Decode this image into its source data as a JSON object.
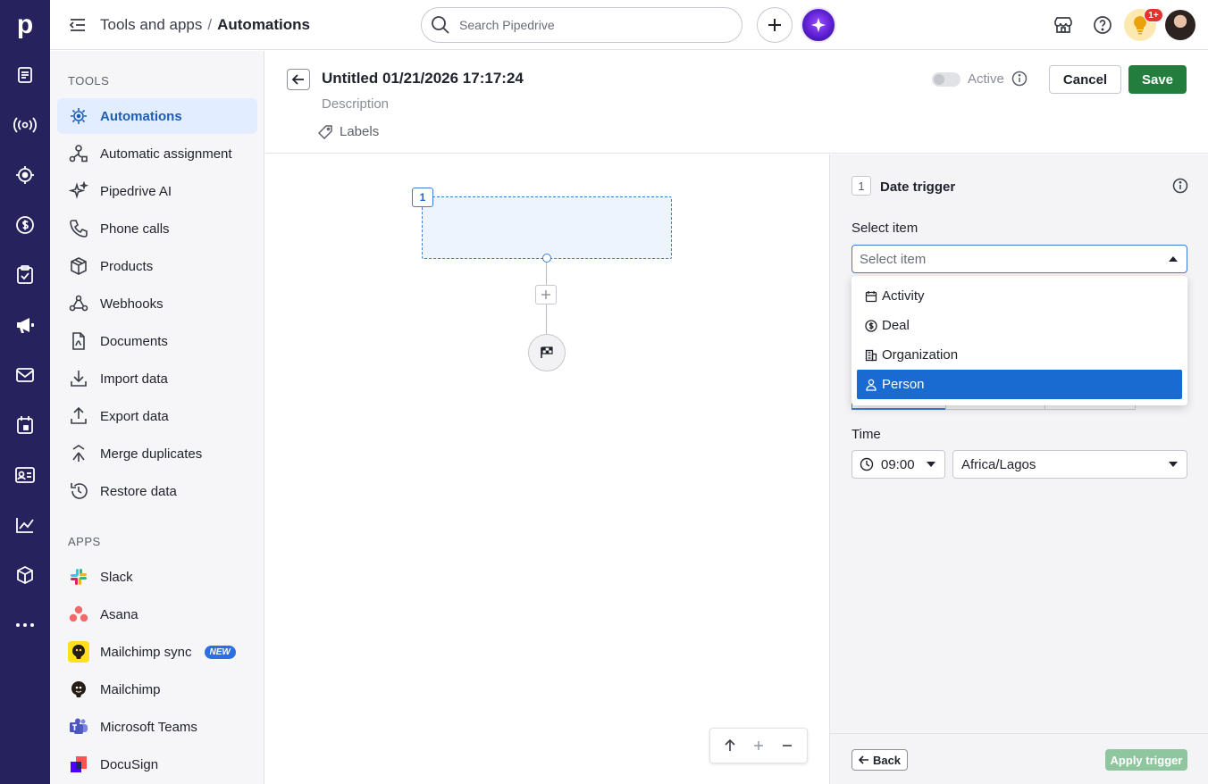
{
  "rail": {
    "logo": "p",
    "icons": [
      "leads-icon",
      "campaigns-radio-icon",
      "target-icon",
      "deals-dollar-icon",
      "tasks-clipboard-icon",
      "megaphone-icon",
      "mail-icon",
      "calendar-icon",
      "contacts-card-icon",
      "insights-chart-icon",
      "products-box-icon",
      "more-icon"
    ]
  },
  "topbar": {
    "breadcrumb_parent": "Tools and apps",
    "breadcrumb_sep": "/",
    "breadcrumb_current": "Automations",
    "search_placeholder": "Search Pipedrive",
    "notification_count": "1+"
  },
  "sidebar": {
    "tools_heading": "TOOLS",
    "tools": [
      {
        "label": "Automations",
        "icon": "automation-bot-icon",
        "active": true
      },
      {
        "label": "Automatic assignment",
        "icon": "assignment-icon"
      },
      {
        "label": "Pipedrive AI",
        "icon": "sparkle-icon"
      },
      {
        "label": "Phone calls",
        "icon": "phone-icon"
      },
      {
        "label": "Products",
        "icon": "box-icon"
      },
      {
        "label": "Webhooks",
        "icon": "webhook-icon"
      },
      {
        "label": "Documents",
        "icon": "document-icon"
      },
      {
        "label": "Import data",
        "icon": "import-icon"
      },
      {
        "label": "Export data",
        "icon": "export-icon"
      },
      {
        "label": "Merge duplicates",
        "icon": "merge-icon"
      },
      {
        "label": "Restore data",
        "icon": "restore-icon"
      }
    ],
    "apps_heading": "APPS",
    "apps": [
      {
        "label": "Slack",
        "icon": "slack-icon"
      },
      {
        "label": "Asana",
        "icon": "asana-icon"
      },
      {
        "label": "Mailchimp sync",
        "icon": "mailchimp-icon",
        "badge": "NEW"
      },
      {
        "label": "Mailchimp",
        "icon": "mailchimp-icon"
      },
      {
        "label": "Microsoft Teams",
        "icon": "teams-icon"
      },
      {
        "label": "DocuSign",
        "icon": "docusign-icon"
      }
    ]
  },
  "editor": {
    "title": "Untitled 01/21/2026 17:17:24",
    "description_placeholder": "Description",
    "labels_text": "Labels",
    "active_label": "Active",
    "active_on": false,
    "cancel_label": "Cancel",
    "save_label": "Save"
  },
  "canvas": {
    "step_number": "1"
  },
  "panel": {
    "step_number": "1",
    "title": "Date trigger",
    "select_label": "Select item",
    "select_placeholder": "Select item",
    "options": [
      {
        "label": "Activity",
        "icon": "calendar-icon"
      },
      {
        "label": "Deal",
        "icon": "dollar-icon"
      },
      {
        "label": "Organization",
        "icon": "building-icon"
      },
      {
        "label": "Person",
        "icon": "person-icon",
        "selected": true
      }
    ],
    "time_label": "Time",
    "time_value": "09:00",
    "timezone_value": "Africa/Lagos",
    "back_label": "Back",
    "apply_label": "Apply trigger"
  },
  "colors": {
    "rail": "#26225e",
    "accent": "#1a6bd1",
    "save_green": "#237e3e",
    "apply_disabled": "#8fc6a0"
  }
}
